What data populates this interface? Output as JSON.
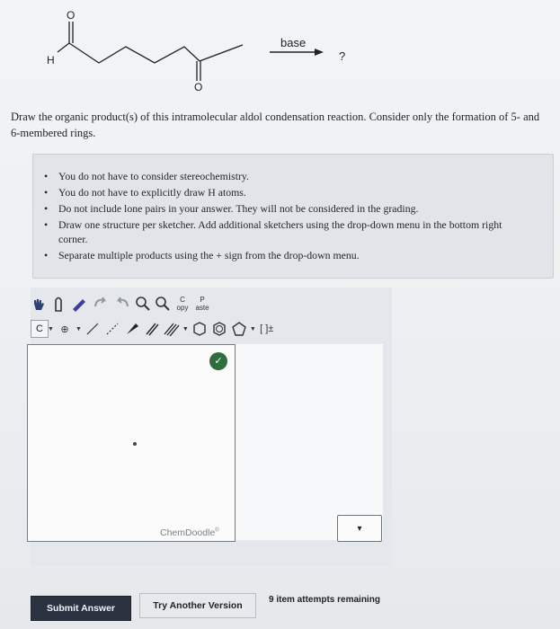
{
  "reaction": {
    "atom_labels": [
      "O",
      "H",
      "O"
    ],
    "reagent": "base",
    "product": "?"
  },
  "question": {
    "text": "Draw the organic product(s) of this intramolecular aldol condensation reaction. Consider only the formation of 5- and 6-membered rings."
  },
  "notes": [
    "You do not have to consider stereochemistry.",
    "You do not have to explicitly draw H atoms.",
    "Do not include lone pairs in your answer. They will not be considered in the grading.",
    "Draw one structure per sketcher. Add additional sketchers using the drop-down menu in the bottom right corner.",
    "Separate multiple products using the + sign from the drop-down menu."
  ],
  "toolbar": {
    "copy_top": "C",
    "copy_bottom": "opy",
    "paste_top": "P",
    "paste_bottom": "aste",
    "element": "C",
    "charge": "[ ]±"
  },
  "sketcher": {
    "watermark": "ChemDoodle",
    "watermark_mark": "®"
  },
  "footer": {
    "submit": "Submit Answer",
    "try_another": "Try Another Version",
    "attempts": "9 item attempts remaining"
  }
}
